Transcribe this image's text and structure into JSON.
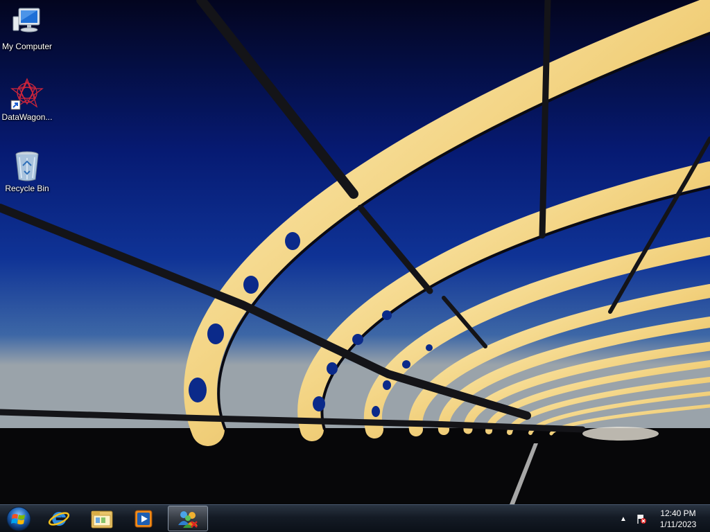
{
  "desktop": {
    "icons": [
      {
        "label": "My Computer",
        "icon": "computer-icon"
      },
      {
        "label": "DataWagon...",
        "icon": "datawagon-shortcut-icon"
      },
      {
        "label": "Recycle Bin",
        "icon": "recycle-bin-icon"
      }
    ]
  },
  "taskbar": {
    "start_icon": "windows-start-orb-icon",
    "pinned": [
      {
        "name": "Internet Explorer",
        "icon": "internet-explorer-icon"
      },
      {
        "name": "Windows Explorer",
        "icon": "folder-explorer-icon"
      },
      {
        "name": "Windows Media Player",
        "icon": "media-player-icon"
      },
      {
        "name": "Remote Desktop Users",
        "icon": "users-network-icon",
        "active": true
      }
    ],
    "tray": {
      "show_hidden_icon": "up-arrow-icon",
      "action_center_icon": "flag-error-icon",
      "time": "12:40 PM",
      "date": "1/11/2023"
    }
  }
}
